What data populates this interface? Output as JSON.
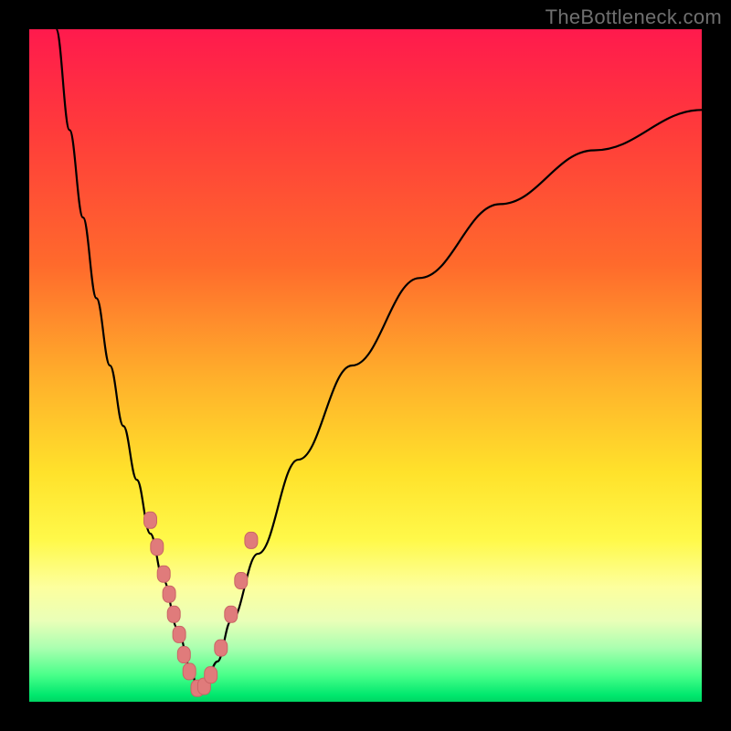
{
  "attribution": "TheBottleneck.com",
  "chart_data": {
    "type": "line",
    "title": "",
    "xlabel": "",
    "ylabel": "",
    "xlim": [
      0,
      100
    ],
    "ylim": [
      0,
      100
    ],
    "background_gradient": {
      "top_color": "#ff1a4d",
      "bottom_color": "#00d563",
      "meaning": "top=high-bottleneck (bad), bottom=low-bottleneck (good)"
    },
    "curve_minimum_x": 25,
    "series": [
      {
        "name": "bottleneck-curve",
        "x": [
          4,
          6,
          8,
          10,
          12,
          14,
          16,
          18,
          20,
          22,
          24,
          25,
          26,
          28,
          30,
          34,
          40,
          48,
          58,
          70,
          84,
          100
        ],
        "y": [
          100,
          85,
          72,
          60,
          50,
          41,
          33,
          25,
          18,
          11,
          5,
          2,
          2.5,
          6,
          12,
          22,
          36,
          50,
          63,
          74,
          82,
          88
        ]
      },
      {
        "name": "data-points",
        "x": [
          18,
          19,
          20,
          20.8,
          21.5,
          22.3,
          23,
          23.8,
          25,
          26,
          27,
          28.5,
          30,
          31.5,
          33
        ],
        "y": [
          27,
          23,
          19,
          16,
          13,
          10,
          7,
          4.5,
          2,
          2.3,
          4,
          8,
          13,
          18,
          24
        ]
      }
    ]
  }
}
